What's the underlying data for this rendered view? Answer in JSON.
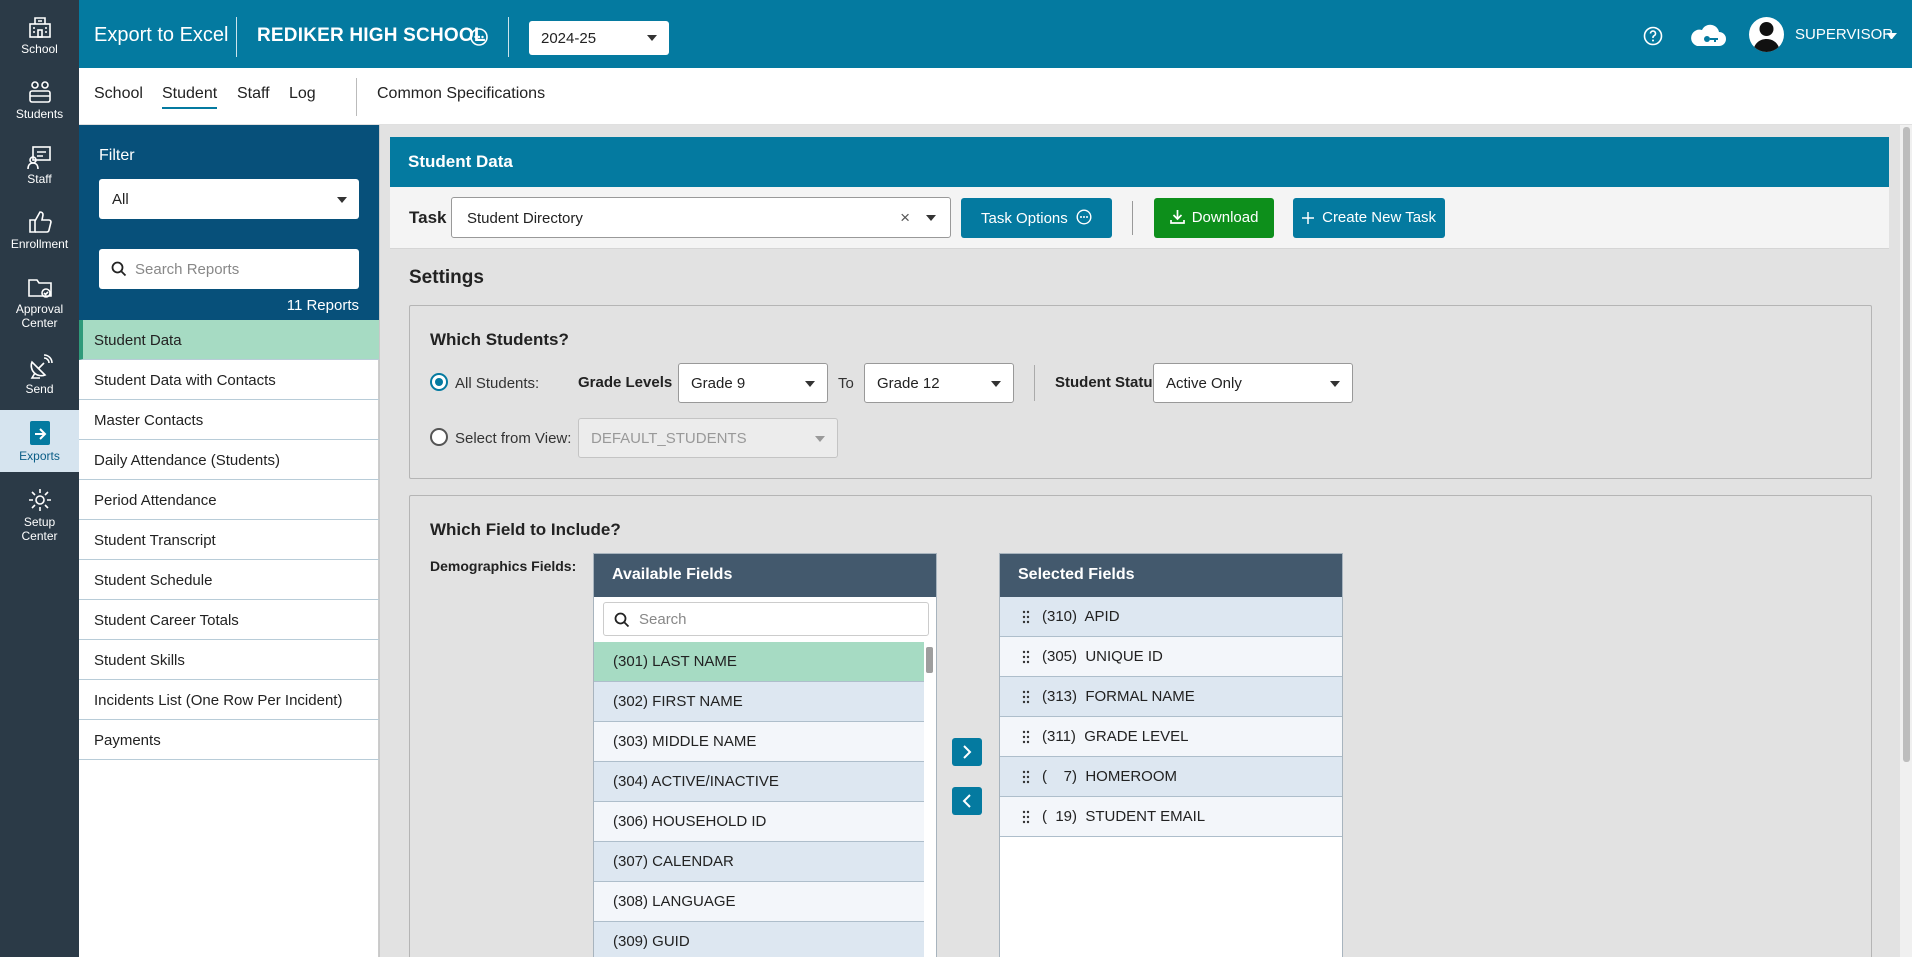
{
  "rail": {
    "items": [
      {
        "label": "School"
      },
      {
        "label": "Students"
      },
      {
        "label": "Staff"
      },
      {
        "label": "Enrollment"
      },
      {
        "label_line1": "Approval",
        "label_line2": "Center"
      },
      {
        "label": "Send"
      },
      {
        "label": "Exports"
      },
      {
        "label_line1": "Setup",
        "label_line2": "Center"
      }
    ]
  },
  "topbar": {
    "app_title": "Export to Excel",
    "school_name": "REDIKER HIGH SCHOOL",
    "year": "2024-25",
    "user": "SUPERVISOR"
  },
  "subnav": {
    "tabs": [
      "School",
      "Student",
      "Staff",
      "Log"
    ],
    "extra": "Common Specifications"
  },
  "panel": {
    "filter_label": "Filter",
    "filter_value": "All",
    "search_placeholder": "Search Reports",
    "reports_count": "11 Reports",
    "reports": [
      "Student Data",
      "Student Data with Contacts",
      "Master Contacts",
      "Daily Attendance (Students)",
      "Period Attendance",
      "Student Transcript",
      "Student Schedule",
      "Student Career Totals",
      "Student Skills",
      "Incidents List (One Row Per Incident)",
      "Payments"
    ]
  },
  "main": {
    "card_title": "Student Data",
    "task_label": "Task",
    "task_value": "Student Directory",
    "task_clear": "×",
    "task_options_label": "Task Options",
    "download_label": "Download",
    "create_label": "Create New Task",
    "settings_title": "Settings",
    "which_students": {
      "title": "Which Students?",
      "all_students": "All Students:",
      "grade_levels": "Grade Levels",
      "grade_from": "Grade 9",
      "to": "To",
      "grade_to": "Grade 12",
      "student_status": "Student Status",
      "status_value": "Active Only",
      "select_from_view": "Select from View:",
      "view_value": "DEFAULT_STUDENTS"
    },
    "fields": {
      "title": "Which Field to Include?",
      "demographics_label": "Demographics Fields:",
      "available_title": "Available Fields",
      "search_placeholder": "Search",
      "available": [
        "(301)  LAST NAME",
        "(302)  FIRST NAME",
        "(303)  MIDDLE NAME",
        "(304)  ACTIVE/INACTIVE",
        "(306)  HOUSEHOLD ID",
        "(307)  CALENDAR",
        "(308)  LANGUAGE",
        "(309)  GUID"
      ],
      "selected_title": "Selected Fields",
      "selected": [
        "(310)  APID",
        "(305)  UNIQUE ID",
        "(313)  FORMAL NAME",
        "(311)  GRADE LEVEL",
        "(    7)  HOMEROOM",
        "(  19)  STUDENT EMAIL"
      ]
    }
  }
}
